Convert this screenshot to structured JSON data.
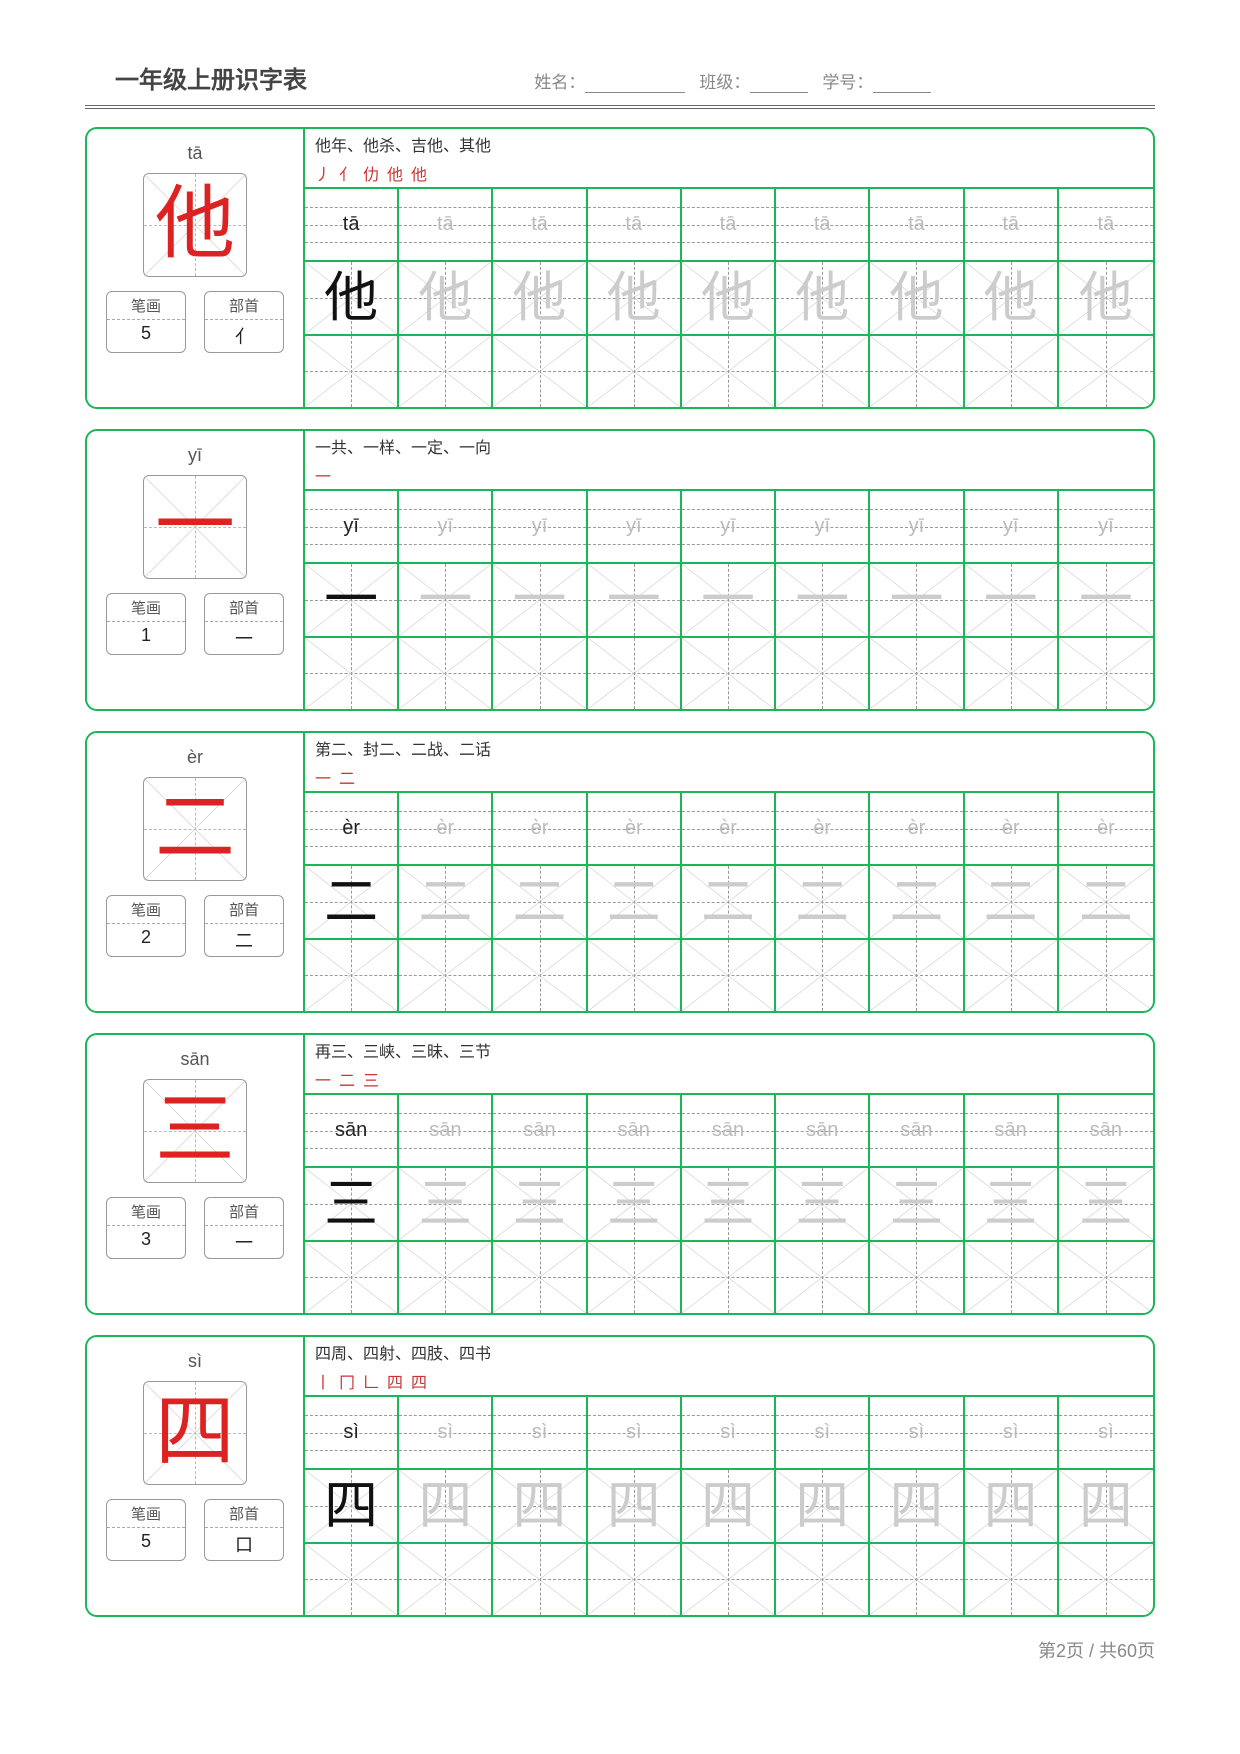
{
  "header": {
    "title": "一年级上册识字表",
    "name_label": "姓名：",
    "class_label": "班级：",
    "id_label": "学号："
  },
  "labels": {
    "strokes": "笔画",
    "radical": "部首"
  },
  "footer": "第2页 / 共60页",
  "entries": [
    {
      "pinyin": "tā",
      "character": "他",
      "strokes": "5",
      "radical": "亻",
      "words": "他年、他杀、吉他、其他",
      "stroke_seq": "丿 亻 仂 他 他"
    },
    {
      "pinyin": "yī",
      "character": "一",
      "strokes": "1",
      "radical": "一",
      "words": "一共、一样、一定、一向",
      "stroke_seq": "一"
    },
    {
      "pinyin": "èr",
      "character": "二",
      "strokes": "2",
      "radical": "二",
      "words": "第二、封二、二战、二话",
      "stroke_seq": "一 二"
    },
    {
      "pinyin": "sān",
      "character": "三",
      "strokes": "3",
      "radical": "一",
      "words": "再三、三峡、三昧、三节",
      "stroke_seq": "一 二 三"
    },
    {
      "pinyin": "sì",
      "character": "四",
      "strokes": "5",
      "radical": "口",
      "words": "四周、四射、四肢、四书",
      "stroke_seq": "丨 冂 𠃊 四 四"
    }
  ]
}
